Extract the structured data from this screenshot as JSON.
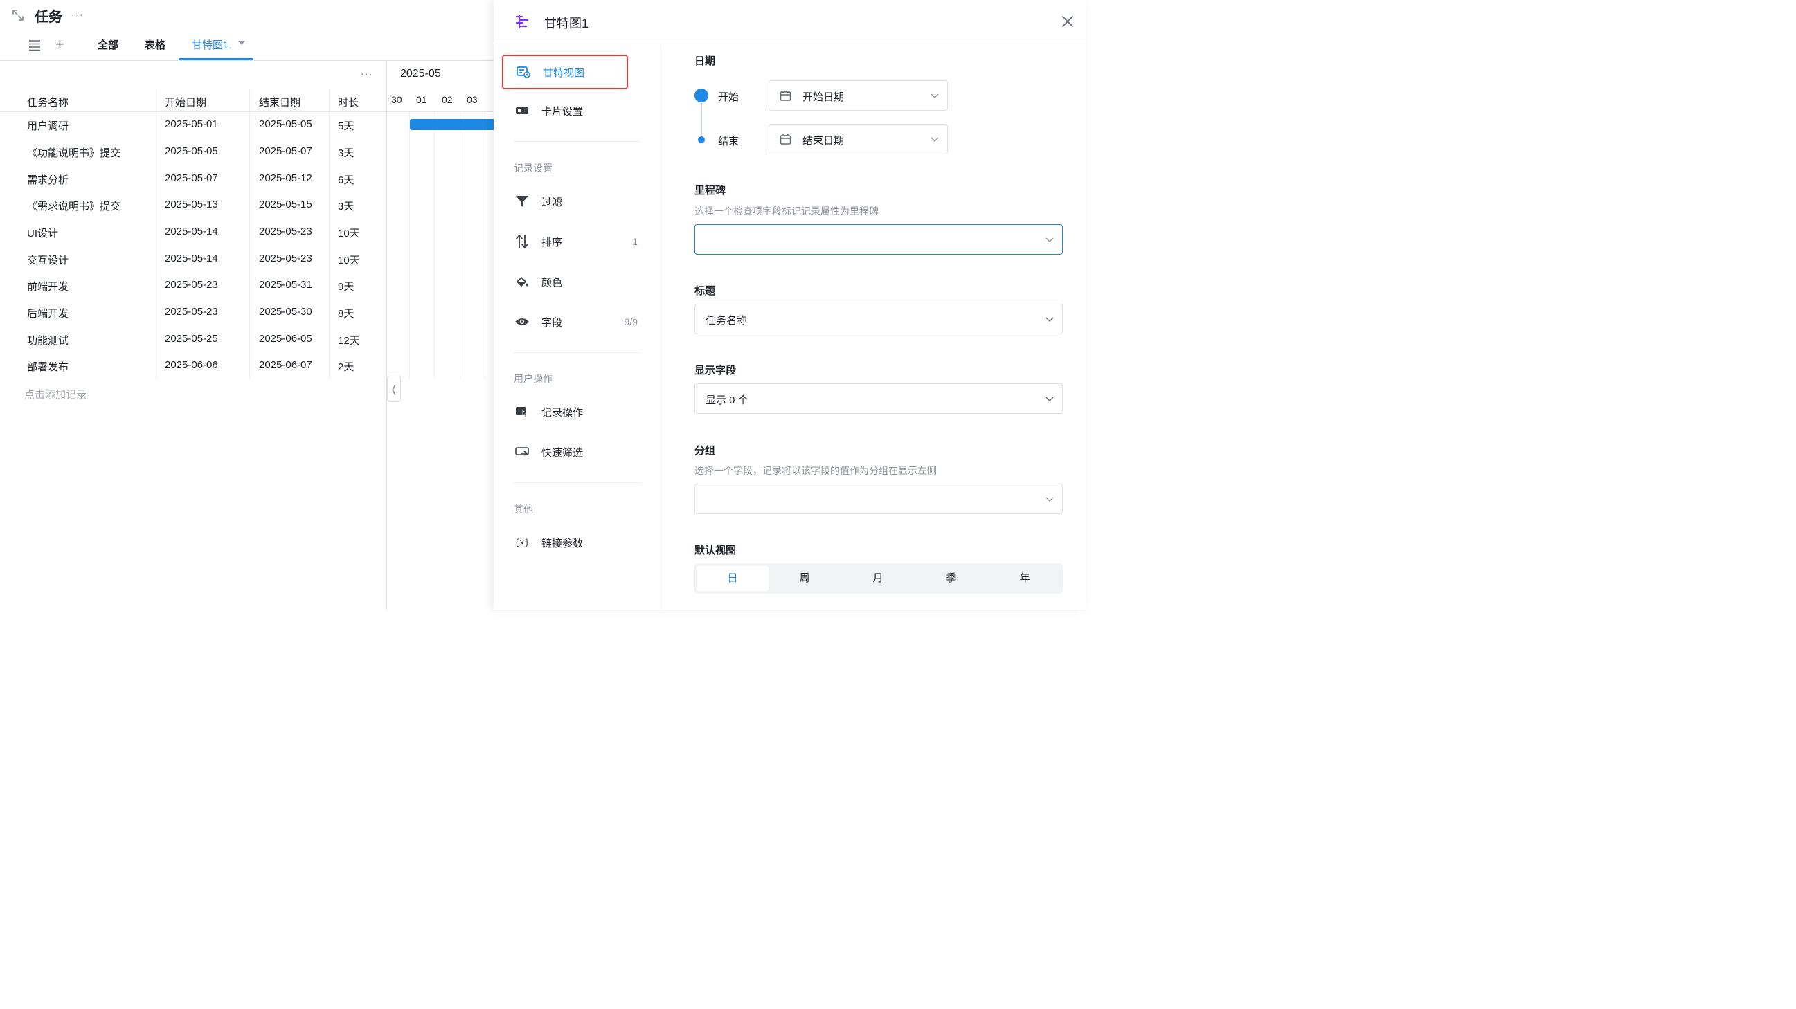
{
  "page": {
    "title": "任务",
    "more": "···"
  },
  "tabs": {
    "items": [
      {
        "label": "全部"
      },
      {
        "label": "表格"
      },
      {
        "label": "甘特图1"
      }
    ]
  },
  "table": {
    "more": "···",
    "columns": [
      "任务名称",
      "开始日期",
      "结束日期",
      "时长"
    ],
    "rows": [
      [
        "用户调研",
        "2025-05-01",
        "2025-05-05",
        "5天"
      ],
      [
        "《功能说明书》提交",
        "2025-05-05",
        "2025-05-07",
        "3天"
      ],
      [
        "需求分析",
        "2025-05-07",
        "2025-05-12",
        "6天"
      ],
      [
        "《需求说明书》提交",
        "2025-05-13",
        "2025-05-15",
        "3天"
      ],
      [
        "UI设计",
        "2025-05-14",
        "2025-05-23",
        "10天"
      ],
      [
        "交互设计",
        "2025-05-14",
        "2025-05-23",
        "10天"
      ],
      [
        "前端开发",
        "2025-05-23",
        "2025-05-31",
        "9天"
      ],
      [
        "后端开发",
        "2025-05-23",
        "2025-05-30",
        "8天"
      ],
      [
        "功能测试",
        "2025-05-25",
        "2025-06-05",
        "12天"
      ],
      [
        "部署发布",
        "2025-06-06",
        "2025-06-07",
        "2天"
      ]
    ],
    "add_record": "点击添加记录"
  },
  "gantt": {
    "month": "2025-05",
    "days": [
      "30",
      "01",
      "02",
      "03"
    ],
    "collapse_glyph": "❬"
  },
  "drawer": {
    "title": "甘特图1",
    "nav": {
      "gantt_view": "甘特视图",
      "card_settings": "卡片设置",
      "section_record": "记录设置",
      "filter": "过滤",
      "sort": "排序",
      "sort_count": "1",
      "color": "颜色",
      "fields": "字段",
      "fields_count": "9/9",
      "section_user": "用户操作",
      "record_actions": "记录操作",
      "quick_filter": "快速筛选",
      "section_other": "其他",
      "link_params": "链接参数"
    },
    "form": {
      "date_label": "日期",
      "start_label": "开始",
      "start_value": "开始日期",
      "end_label": "结束",
      "end_value": "结束日期",
      "milestone_label": "里程碑",
      "milestone_hint": "选择一个检查项字段标记记录属性为里程碑",
      "milestone_value": "",
      "title_label": "标题",
      "title_value": "任务名称",
      "display_label": "显示字段",
      "display_value": "显示 0 个",
      "group_label": "分组",
      "group_hint": "选择一个字段，记录将以该字段的值作为分组在显示左侧",
      "group_value": "",
      "default_view_label": "默认视图",
      "default_view_options": [
        "日",
        "周",
        "月",
        "季",
        "年"
      ],
      "default_view_selected": "日"
    }
  },
  "colors": {
    "accent": "#1e88e5",
    "highlight_border": "#e53935",
    "gantt_icon": "#7c3aed"
  }
}
